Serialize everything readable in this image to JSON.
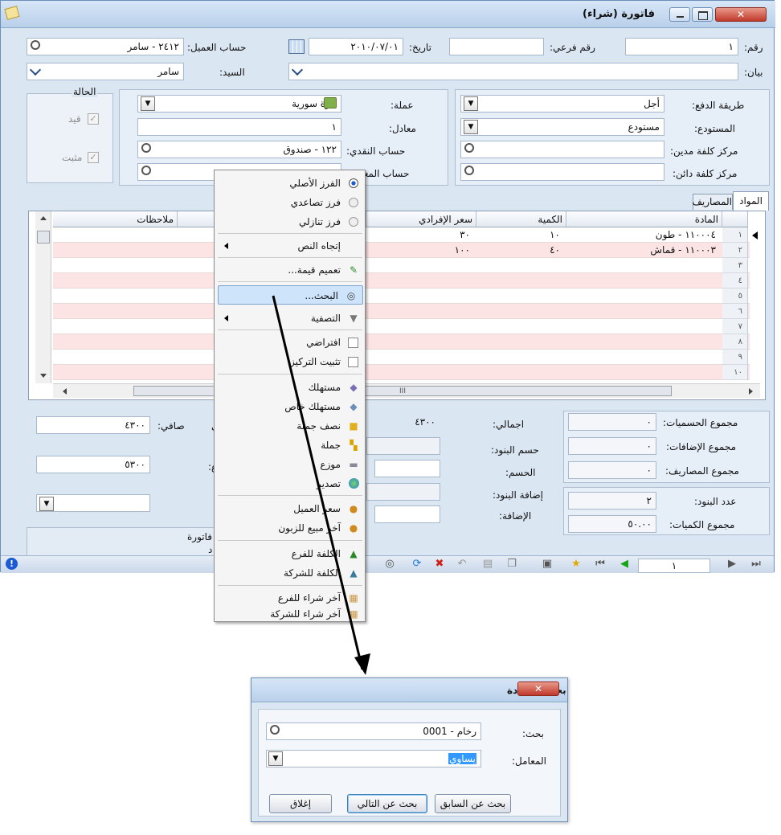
{
  "window": {
    "title": "فاتورة (شراء)",
    "close_glyph": "✕",
    "app_icon": "notepad-icon"
  },
  "header": {
    "number_label": "رقم:",
    "number_value": "١",
    "sub_number_label": "رقم فرعي:",
    "sub_number_value": "",
    "date_label": "تاريخ:",
    "date_value": "٢٠١٠/٠٧/٠١",
    "customer_account_label": "حساب العميل:",
    "customer_account_value": "٢٤١٢ - سامر",
    "statement_label": "بيان:",
    "statement_value": "",
    "mister_label": "السيد:",
    "mister_value": "سامر"
  },
  "payment": {
    "method_label": "طريقة الدفع:",
    "method_value": "أجل",
    "warehouse_label": "المستودع:",
    "warehouse_value": "مستودع",
    "debit_center_label": "مركز كلفة مدين:",
    "debit_center_value": "",
    "credit_center_label": "مركز كلفة دائن:",
    "credit_center_value": ""
  },
  "currency": {
    "currency_label": "عملة:",
    "currency_value": "ليرة سورية",
    "rate_label": "معادل:",
    "rate_value": "١",
    "cash_account_label": "حساب النقدي:",
    "cash_account_value": "١٢٢ - صندوق",
    "equiv_account_label": "حساب المعادل:",
    "equiv_account_value": ""
  },
  "status": {
    "title": "الحالة",
    "recorded_label": "قيد",
    "posted_label": "مثبت"
  },
  "tabs": [
    "المواد",
    "المصاريف"
  ],
  "table": {
    "headers": [
      "المادة",
      "الكمية",
      "سعر الإفرادي",
      "",
      "ملاحظات"
    ],
    "rows": [
      {
        "num": "١",
        "item": "١١٠٠٠٤ - طون",
        "qty": "١٠",
        "price": "٣٠"
      },
      {
        "num": "٢",
        "item": "١١٠٠٠٣ - قماش",
        "qty": "٤٠",
        "price": "١٠٠"
      },
      {
        "num": "٣",
        "item": "",
        "qty": "",
        "price": ""
      },
      {
        "num": "٤",
        "item": "",
        "qty": "",
        "price": ""
      },
      {
        "num": "٥",
        "item": "",
        "qty": "",
        "price": ""
      },
      {
        "num": "٦",
        "item": "",
        "qty": "",
        "price": ""
      },
      {
        "num": "٧",
        "item": "",
        "qty": "",
        "price": ""
      },
      {
        "num": "٨",
        "item": "",
        "qty": "",
        "price": ""
      },
      {
        "num": "٩",
        "item": "",
        "qty": "",
        "price": ""
      },
      {
        "num": "١٠",
        "item": "",
        "qty": "",
        "price": ""
      }
    ],
    "scroll_marker": "III"
  },
  "totals": {
    "discounts_sum_label": "مجموع الحسميات:",
    "discounts_sum_value": "٠",
    "additions_sum_label": "مجموع الإضافات:",
    "additions_sum_value": "٠",
    "expenses_sum_label": "مجموع المصاريف:",
    "expenses_sum_value": "٠",
    "items_count_label": "عدد البنود:",
    "items_count_value": "٢",
    "quantities_sum_label": "مجموع الكميات:",
    "quantities_sum_value": "٥٠.٠٠",
    "total_label": "اجمالي:",
    "total_value": "٤٣٠٠",
    "items_discount_label": "حسم البنود:",
    "discount_label": "الحسم:",
    "items_addition_label": "إضافة البنود:",
    "addition_label": "الإضافة:",
    "net_label": "صافي:",
    "net_value": "٤٣٠٠",
    "partial_label": "ي",
    "second_value": "٥٣٠٠",
    "second_label": "ع:",
    "box_label": "فاتورة",
    "box_sub": "د"
  },
  "context_menu": {
    "items": [
      {
        "label": "الفرز الأصلي",
        "icon": "radio-checked-icon"
      },
      {
        "label": "فرز تصاعدي",
        "icon": "radio-icon"
      },
      {
        "label": "فرز تنازلي",
        "icon": "radio-icon"
      },
      {
        "label": "إتجاه النص",
        "icon": "submenu-arrow-icon"
      },
      {
        "label": "تعميم قيمة...",
        "icon": "edit-note-icon"
      },
      {
        "label": "البحث...",
        "icon": "binoculars-icon"
      },
      {
        "label": "التصفية",
        "icon": "filter-icon"
      },
      {
        "label": "افتراضي",
        "icon": "checkbox-icon"
      },
      {
        "label": "تثبيت التركيز",
        "icon": "checkbox-icon"
      },
      {
        "label": "مستهلك",
        "icon": "consumer-icon"
      },
      {
        "label": "مستهلك خاص",
        "icon": "special-consumer-icon"
      },
      {
        "label": "نصف جملة",
        "icon": "box-icon"
      },
      {
        "label": "جملة",
        "icon": "boxes-icon"
      },
      {
        "label": "موزع",
        "icon": "truck-icon"
      },
      {
        "label": "تصدير",
        "icon": "globe-icon"
      },
      {
        "label": "سعر العميل",
        "icon": "user-icon"
      },
      {
        "label": "آخر مبيع للزبون",
        "icon": "user-icon"
      },
      {
        "label": "الكلفة للفرع",
        "icon": "chart-icon"
      },
      {
        "label": "الكلفة للشركة",
        "icon": "chart-icon"
      },
      {
        "label": "آخر شراء للفرع",
        "icon": "calendar-icon"
      },
      {
        "label": "آخر شراء للشركة",
        "icon": "calendar-icon"
      }
    ]
  },
  "navigator": {
    "page_value": "١"
  },
  "dialog": {
    "title": "بحث - المادة",
    "close_glyph": "✕",
    "search_label": "بحث:",
    "search_value": "0001 - رخام",
    "operator_label": "المعامل:",
    "operator_value": "يساوي",
    "find_prev_label": "بحث عن السابق",
    "find_next_label": "بحث عن التالي",
    "close_label": "إغلاق"
  }
}
